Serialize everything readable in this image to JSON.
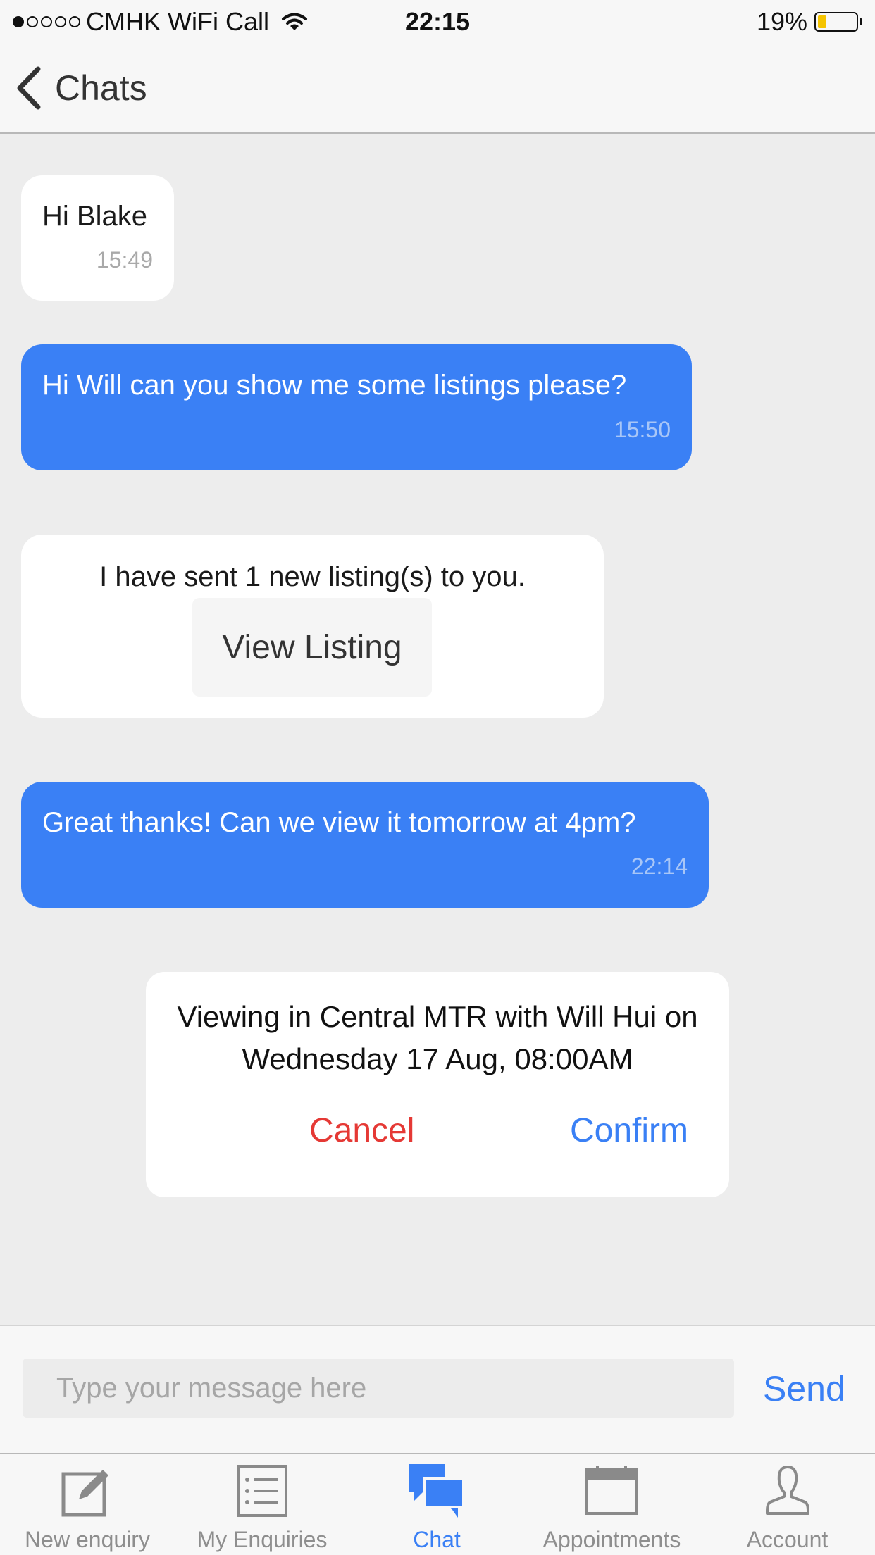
{
  "status_bar": {
    "carrier": "CMHK WiFi Call",
    "time": "22:15",
    "battery": "19%",
    "battery_level": 0.19,
    "signal_bars_filled": 1,
    "signal_bars_total": 5
  },
  "nav": {
    "back_label": "Chats"
  },
  "messages": [
    {
      "direction": "incoming",
      "text": "Hi Blake",
      "time": "15:49"
    },
    {
      "direction": "outgoing",
      "text": "Hi Will can you show me some listings please?",
      "time": "15:50"
    },
    {
      "direction": "incoming",
      "text": "I have sent 1 new listing(s) to you.",
      "button_label": "View Listing"
    },
    {
      "direction": "outgoing",
      "text": "Great thanks! Can we view it tomorrow at 4pm?",
      "time": "22:14"
    }
  ],
  "appointment": {
    "line1": "Viewing in Central MTR with Will Hui on",
    "line2": "Wednesday 17 Aug, 08:00AM",
    "cancel_label": "Cancel",
    "confirm_label": "Confirm"
  },
  "composer": {
    "placeholder": "Type your message here",
    "send_label": "Send"
  },
  "tabs": [
    {
      "label": "New enquiry",
      "icon": "compose-icon",
      "active": false
    },
    {
      "label": "My Enquiries",
      "icon": "list-icon",
      "active": false
    },
    {
      "label": "Chat",
      "icon": "chat-icon",
      "active": true
    },
    {
      "label": "Appointments",
      "icon": "calendar-icon",
      "active": false
    },
    {
      "label": "Account",
      "icon": "person-icon",
      "active": false
    }
  ],
  "colors": {
    "accent": "#3a80f5",
    "cancel": "#e53935",
    "background": "#ededed",
    "battery": "#f5c400"
  }
}
